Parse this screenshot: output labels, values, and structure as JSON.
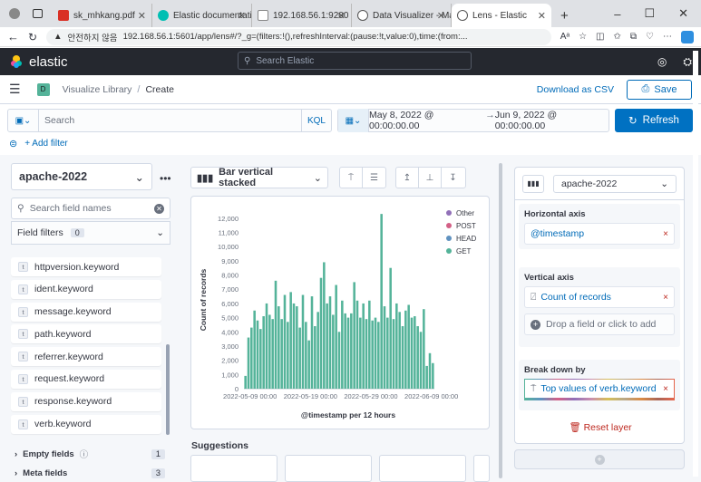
{
  "browser": {
    "tabs": [
      {
        "title": "sk_mhkang.pdf",
        "icon": "pdf-icon",
        "color": "#d93025"
      },
      {
        "title": "Elastic documentatio",
        "icon": "elastic-docs-icon",
        "color": "#00bfb3"
      },
      {
        "title": "192.168.56.1:9200",
        "icon": "page-icon",
        "color": "#888888"
      },
      {
        "title": "Data Visualizer - Mac",
        "icon": "globe-icon",
        "color": "#555555"
      },
      {
        "title": "Lens - Elastic",
        "icon": "globe-icon",
        "color": "#555555"
      }
    ],
    "new_tab": "+",
    "security_label": "안전하지 않음",
    "url": "192.168.56.1:5601/app/lens#/?_g=(filters:!(),refreshInterval:(pause:!t,value:0),time:(from:..."
  },
  "kibana": {
    "brand": "elastic",
    "search_placeholder": "Search Elastic",
    "space_badge": "D",
    "breadcrumbs": [
      "Visualize Library",
      "Create"
    ],
    "download_csv": "Download as CSV",
    "save": "Save"
  },
  "query": {
    "placeholder": "Search",
    "language": "KQL",
    "date_from": "May 8, 2022 @ 00:00:00.00",
    "arrow": "→",
    "date_to": "Jun 9, 2022 @ 00:00:00.00",
    "refresh": "Refresh",
    "add_filter": "+ Add filter"
  },
  "left": {
    "index_pattern": "apache-2022",
    "field_search_placeholder": "Search field names",
    "field_filters_label": "Field filters",
    "field_filters_count": "0",
    "fields": [
      "httpversion.keyword",
      "ident.keyword",
      "message.keyword",
      "path.keyword",
      "referrer.keyword",
      "request.keyword",
      "response.keyword",
      "verb.keyword"
    ],
    "field_type_glyph": "t",
    "empty_fields_label": "Empty fields",
    "empty_fields_count": "1",
    "meta_fields_label": "Meta fields",
    "meta_fields_count": "3"
  },
  "center": {
    "chart_type": "Bar vertical stacked",
    "suggestions_title": "Suggestions"
  },
  "chart_data": {
    "type": "bar",
    "stacked": true,
    "xlabel": "@timestamp per 12 hours",
    "ylabel": "Count of records",
    "ylim": [
      0,
      12500
    ],
    "yticks": [
      0,
      1000,
      2000,
      3000,
      4000,
      5000,
      6000,
      7000,
      8000,
      9000,
      10000,
      11000,
      12000
    ],
    "xtick_labels": [
      "2022-05-09 00:00",
      "2022-05-19 00:00",
      "2022-05-29 00:00",
      "2022-06-09 00:00"
    ],
    "xtick_index": [
      2,
      22,
      42,
      62
    ],
    "legend": [
      "Other",
      "POST",
      "HEAD",
      "GET"
    ],
    "legend_colors": [
      "#9170b8",
      "#d36086",
      "#6092c0",
      "#54b399"
    ],
    "legend_position": "top-right",
    "series": [
      {
        "name": "GET",
        "color": "#54b399",
        "values": [
          900,
          3600,
          4300,
          5500,
          4800,
          4200,
          5100,
          6000,
          5200,
          4900,
          7600,
          5800,
          4900,
          6600,
          4700,
          6800,
          6000,
          5800,
          4300,
          6600,
          4700,
          3400,
          6500,
          4400,
          5400,
          7800,
          8900,
          6000,
          6500,
          5200,
          7300,
          4000,
          6200,
          5300,
          5000,
          5300,
          7500,
          6200,
          5000,
          6000,
          4900,
          6200,
          4800,
          5000,
          4700,
          12300,
          5800,
          5000,
          8500,
          4900,
          6000,
          5400,
          4400,
          5500,
          5900,
          5000,
          5100,
          4400,
          4000,
          5600,
          1600,
          2500,
          1800
        ]
      }
    ]
  },
  "right": {
    "index_pattern": "apache-2022",
    "horizontal_axis_title": "Horizontal axis",
    "horizontal_axis_value": "@timestamp",
    "vertical_axis_title": "Vertical axis",
    "vertical_axis_value": "Count of records",
    "drop_field": "Drop a field or click to add",
    "breakdown_title": "Break down by",
    "breakdown_value": "Top values of verb.keyword",
    "reset_layer": "Reset layer",
    "remove_glyph": "×"
  }
}
